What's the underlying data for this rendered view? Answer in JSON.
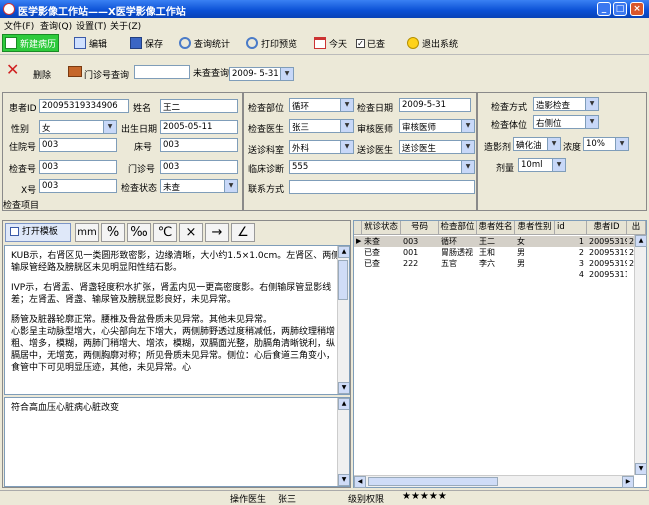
{
  "window": {
    "title": "医学影像工作站——X医学影像工作站"
  },
  "menu": [
    "文件(F)",
    "查询(Q)",
    "设置(T)",
    "关于(Z)"
  ],
  "toolbar": {
    "new_record": "新建病历",
    "edit": "编辑",
    "save": "保存",
    "query_stats": "查询统计",
    "print_preview": "打印预览",
    "today": "今天",
    "checked": "已查",
    "exit": "退出系统"
  },
  "filter": {
    "delete": "删除",
    "outpatient_query": "门诊号查询",
    "unchecked_query": "未查查询",
    "date": "2009- 5-31"
  },
  "form": {
    "patient_id_label": "患者ID",
    "patient_id": "20095319334906",
    "name_label": "姓名",
    "name": "王二",
    "gender_label": "性别",
    "gender": "女",
    "dob_label": "出生日期",
    "dob": "2005-05-11",
    "inpatient_label": "住院号",
    "inpatient": "003",
    "bed_label": "床号",
    "bed": "003",
    "exam_no_label": "检查号",
    "exam_no": "003",
    "outpatient_label": "门诊号",
    "outpatient": "003",
    "x_no_label": "X号",
    "x_no": "003",
    "status_label": "检查状态",
    "status": "未查",
    "exam_item_label": "检查项目",
    "exam_part_label": "检查部位",
    "exam_part": "循环",
    "exam_date_label": "检查日期",
    "exam_date": "2009-5-31",
    "doctor_label": "检查医生",
    "doctor": "张三",
    "review_label": "审核医师",
    "review": "审核医师",
    "dept_label": "送诊科室",
    "dept": "外科",
    "ref_doctor_label": "送诊医生",
    "ref_doctor": "送诊医生",
    "clinical_label": "临床诊断",
    "clinical": "555",
    "contact_label": "联系方式",
    "method_label": "检查方式",
    "method": "造影检查",
    "position_label": "检查体位",
    "position": "右侧位",
    "contrast_label": "造影剂",
    "contrast": "碘化油",
    "conc_label": "浓度",
    "conc": "10%",
    "dose_label": "剂量",
    "dose": "10ml"
  },
  "report": {
    "open_template": "打开模板",
    "tools": [
      "mm",
      "%",
      "‰",
      "℃",
      "×",
      "→",
      "∠"
    ],
    "paragraphs": [
      "KUB示，右肾区见一类圆形致密影，边缘清晰，大小约1.5×1.0cm。左肾区、两侧输尿管经路及膀胱区未见明显阳性结石影。",
      "IVP示，右肾盂、肾盏轻度积水扩张，肾盂内见一更高密度影。右侧输尿管显影线差；左肾盂、肾盏、输尿管及膀胱显影良好，未见异常。",
      "肠管及脏器轮廓正常。腰椎及骨盆骨质未见异常。其他未见异常。",
      "心影呈主动脉型增大，心尖部向左下增大，两侧肺野透过度稍减低，两肺纹理稍增粗、增多，模糊，两肺门稍增大、增浓，模糊，双膈面光整，肋膈角清晰锐利，纵膈居中，无增宽，两侧胸廓对称；所见骨质未见异常。侧位：心后食道三角变小，食管中下可见明显压迹，其他，未见异常。心"
    ],
    "conclusion": "符合高血压心脏病心脏改变"
  },
  "grid": {
    "headers": [
      "就诊状态",
      "号码",
      "检查部位",
      "患者姓名",
      "患者性别",
      "id",
      "患者ID",
      "出"
    ],
    "rows": [
      [
        "未查",
        "003",
        "循环",
        "王二",
        "女",
        "1",
        "20095319332",
        "200"
      ],
      [
        "已查",
        "001",
        "胃肠透视",
        "王和",
        "男",
        "2",
        "20095319352",
        "200"
      ],
      [
        "已查",
        "222",
        "五官",
        "李六",
        "男",
        "3",
        "20095319542",
        "200"
      ],
      [
        "",
        "",
        "",
        "",
        "",
        "4",
        "20095311003",
        ""
      ]
    ]
  },
  "status": {
    "doctor_label": "操作医生",
    "doctor": "张三",
    "rank_label": "级别权限",
    "rank": "★★★★★"
  }
}
